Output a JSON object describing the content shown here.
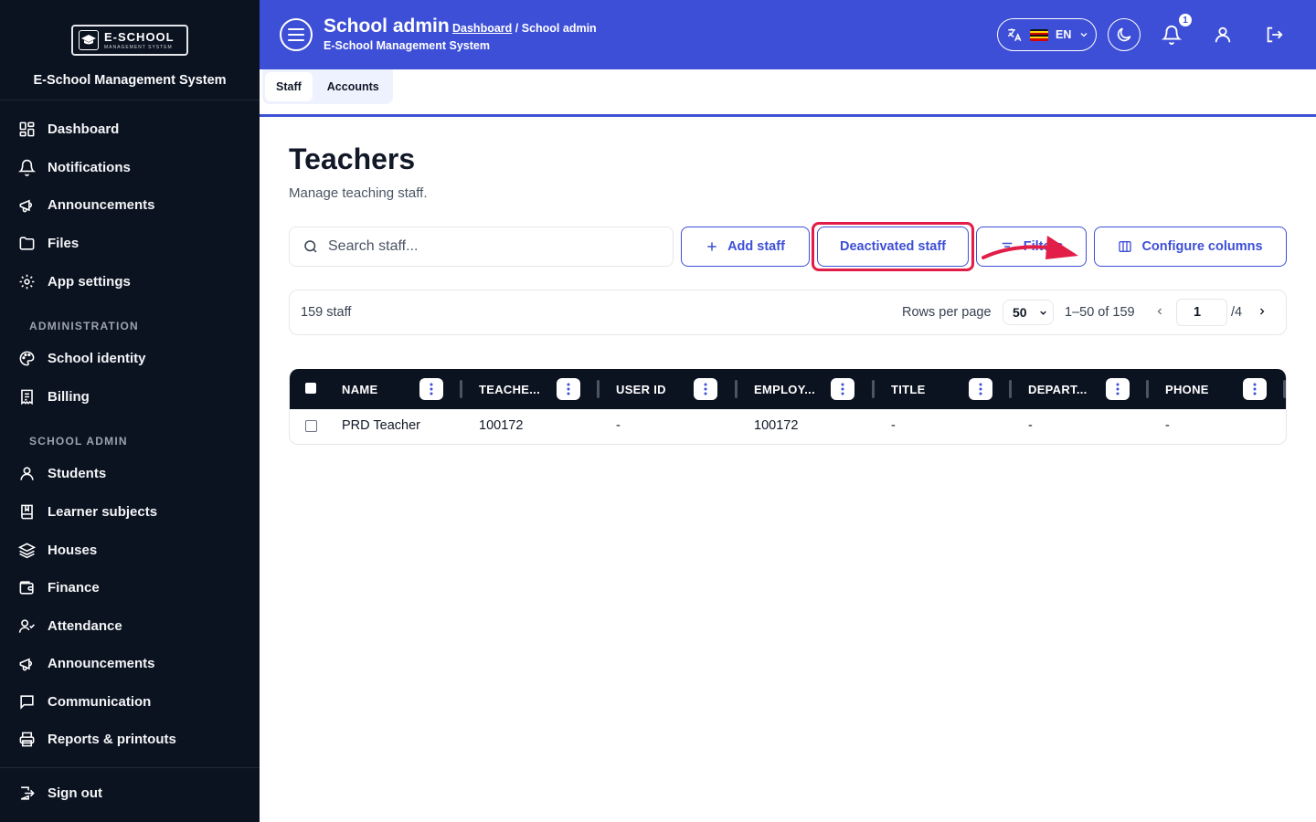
{
  "sidebar": {
    "logo": {
      "big": "E-SCHOOL",
      "small": "MANAGEMENT SYSTEM"
    },
    "system_name": "E-School Management System",
    "items": [
      {
        "label": "Dashboard",
        "icon": "dashboard-icon"
      },
      {
        "label": "Notifications",
        "icon": "bell-icon"
      },
      {
        "label": "Announcements",
        "icon": "megaphone-icon"
      },
      {
        "label": "Files",
        "icon": "folder-icon"
      },
      {
        "label": "App settings",
        "icon": "gear-icon"
      }
    ],
    "admin_section": "ADMINISTRATION",
    "admin_items": [
      {
        "label": "School identity",
        "icon": "palette-icon"
      },
      {
        "label": "Billing",
        "icon": "receipt-icon"
      }
    ],
    "school_section": "SCHOOL ADMIN",
    "school_items": [
      {
        "label": "Students",
        "icon": "user-icon"
      },
      {
        "label": "Learner subjects",
        "icon": "book-icon"
      },
      {
        "label": "Houses",
        "icon": "layers-icon"
      },
      {
        "label": "Finance",
        "icon": "wallet-icon"
      },
      {
        "label": "Attendance",
        "icon": "user-check-icon"
      },
      {
        "label": "Announcements",
        "icon": "megaphone-icon"
      },
      {
        "label": "Communication",
        "icon": "message-icon"
      },
      {
        "label": "Reports & printouts",
        "icon": "printer-icon"
      }
    ],
    "sign_out": "Sign out"
  },
  "header": {
    "title": "School admin",
    "breadcrumb_link": "Dashboard",
    "breadcrumb_current": "/ School admin",
    "subtitle": "E-School Management System",
    "language": "EN",
    "notification_count": "1"
  },
  "tabs": [
    {
      "label": "Staff",
      "active": true
    },
    {
      "label": "Accounts",
      "active": false
    }
  ],
  "page": {
    "title": "Teachers",
    "subtitle": "Manage teaching staff.",
    "search_placeholder": "Search staff...",
    "add_staff": "Add staff",
    "deactivated_staff": "Deactivated staff",
    "filters": "Filters",
    "configure_columns": "Configure columns"
  },
  "toolbar": {
    "count": "159 staff",
    "rows_per_page_label": "Rows per page",
    "rows_per_page": "50",
    "range": "1–50 of 159",
    "page": "1",
    "page_total": "/4"
  },
  "table": {
    "columns": [
      "NAME",
      "TEACHE...",
      "USER ID",
      "EMPLOY...",
      "TITLE",
      "DEPART...",
      "PHONE"
    ],
    "rows": [
      [
        "PRD Teacher",
        "100172",
        "-",
        "100172",
        "-",
        "-",
        "-"
      ]
    ]
  },
  "colors": {
    "primary": "#3d4fd6",
    "sidebar_bg": "#0b1220",
    "highlight": "#e11d48"
  }
}
